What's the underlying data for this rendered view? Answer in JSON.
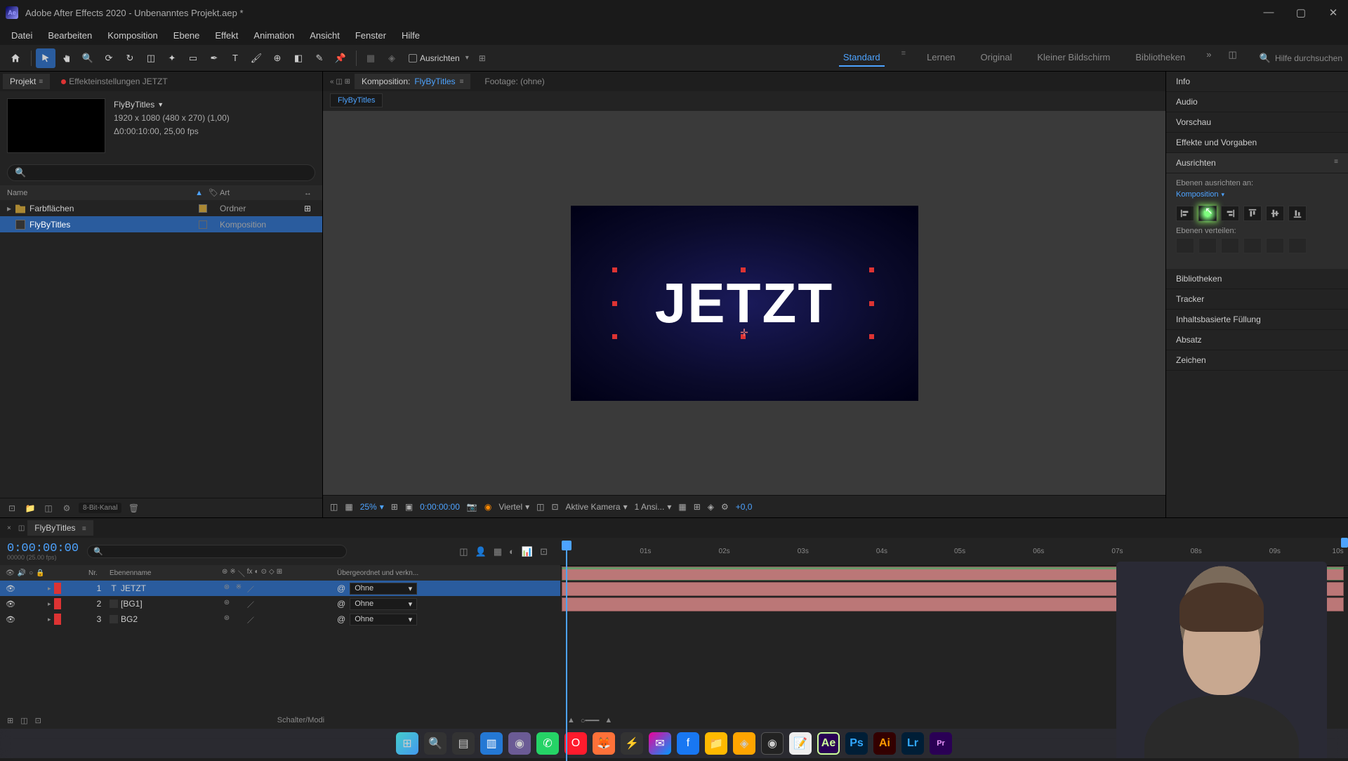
{
  "title": "Adobe After Effects 2020 - Unbenanntes Projekt.aep *",
  "menu": [
    "Datei",
    "Bearbeiten",
    "Komposition",
    "Ebene",
    "Effekt",
    "Animation",
    "Ansicht",
    "Fenster",
    "Hilfe"
  ],
  "toolbar": {
    "snap_label": "Ausrichten",
    "search_help": "Hilfe durchsuchen"
  },
  "workspaces": {
    "items": [
      "Standard",
      "Lernen",
      "Original",
      "Kleiner Bildschirm",
      "Bibliotheken"
    ],
    "active": "Standard"
  },
  "project": {
    "tab": "Projekt",
    "effect_settings": "Effekteinstellungen JETZT",
    "comp_name": "FlyByTitles",
    "dims": "1920 x 1080 (480 x 270) (1,00)",
    "duration": "Δ0:00:10:00, 25,00 fps",
    "cols": {
      "name": "Name",
      "type": "Art"
    },
    "rows": [
      {
        "name": "Farbflächen",
        "type": "Ordner",
        "icon": "folder"
      },
      {
        "name": "FlyByTitles",
        "type": "Komposition",
        "icon": "comp",
        "selected": true
      }
    ],
    "bit": "8-Bit-Kanal"
  },
  "comp_panel": {
    "tab_prefix": "Komposition:",
    "tab_name": "FlyByTitles",
    "footage": "Footage: (ohne)",
    "flowchart": "FlyByTitles",
    "text": "JETZT",
    "zoom": "25%",
    "timecode": "0:00:00:00",
    "resolution": "Viertel",
    "camera": "Aktive Kamera",
    "views": "1 Ansi...",
    "exposure": "+0,0"
  },
  "right_panels": {
    "info": "Info",
    "audio": "Audio",
    "vorschau": "Vorschau",
    "effekte": "Effekte und Vorgaben",
    "ausrichten": "Ausrichten",
    "bibliotheken": "Bibliotheken",
    "tracker": "Tracker",
    "inhalt": "Inhaltsbasierte Füllung",
    "absatz": "Absatz",
    "zeichen": "Zeichen",
    "aus_body": {
      "label1": "Ebenen ausrichten an:",
      "dropdown": "Komposition",
      "label2": "Ebenen verteilen:"
    }
  },
  "timeline": {
    "tab": "FlyByTitles",
    "tc": "0:00:00:00",
    "tc_sub": "00000 (25.00 fps)",
    "cols": {
      "num": "Nr.",
      "name": "Ebenenname",
      "parent": "Übergeordnet und verkn..."
    },
    "layers": [
      {
        "num": "1",
        "name": "JETZT",
        "type": "T",
        "color": "#d33",
        "parent": "Ohne",
        "selected": true
      },
      {
        "num": "2",
        "name": "[BG1]",
        "type": "■",
        "color": "#333",
        "swatch": "#d33",
        "parent": "Ohne"
      },
      {
        "num": "3",
        "name": "BG2",
        "type": "■",
        "color": "#333",
        "swatch": "#d33",
        "parent": "Ohne"
      }
    ],
    "ticks": [
      "01s",
      "02s",
      "03s",
      "04s",
      "05s",
      "06s",
      "07s",
      "08s",
      "09s",
      "10s"
    ],
    "footer": "Schalter/Modi"
  },
  "taskbar_apps": [
    "windows",
    "search",
    "taskview",
    "explorer",
    "teams",
    "whatsapp",
    "opera",
    "firefox",
    "app1",
    "messenger",
    "facebook",
    "folder",
    "app2",
    "obs",
    "notes",
    "ae",
    "ps",
    "ai",
    "lr",
    "pr"
  ]
}
